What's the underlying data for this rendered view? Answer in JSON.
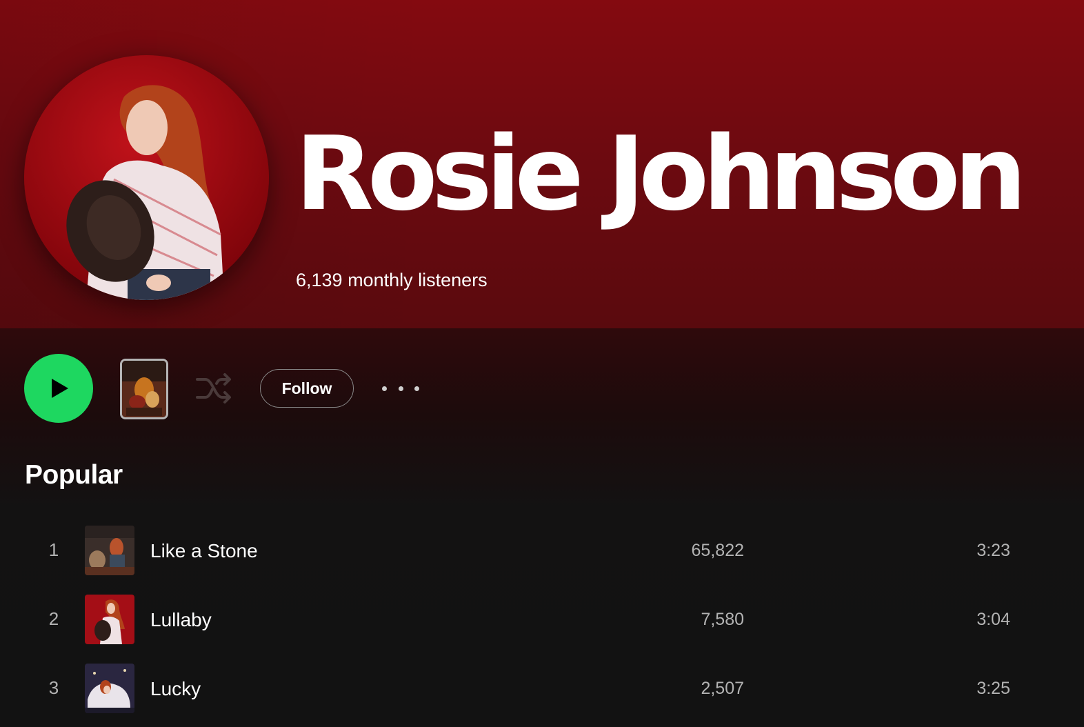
{
  "artist": {
    "name": "Rosie Johnson",
    "monthly_listeners": "6,139 monthly listeners"
  },
  "actions": {
    "follow_label": "Follow",
    "play_icon": "play-icon",
    "shuffle_icon": "shuffle-icon",
    "more_icon": "more-horizontal-icon"
  },
  "popular": {
    "title": "Popular",
    "tracks": [
      {
        "rank": "1",
        "title": "Like a Stone",
        "plays": "65,822",
        "duration": "3:23"
      },
      {
        "rank": "2",
        "title": "Lullaby",
        "plays": "7,580",
        "duration": "3:04"
      },
      {
        "rank": "3",
        "title": "Lucky",
        "plays": "2,507",
        "duration": "3:25"
      }
    ]
  },
  "colors": {
    "hero_red": "#840a10",
    "spotify_green": "#1ed760",
    "background": "#121212",
    "secondary_text": "#b3b3b3"
  }
}
